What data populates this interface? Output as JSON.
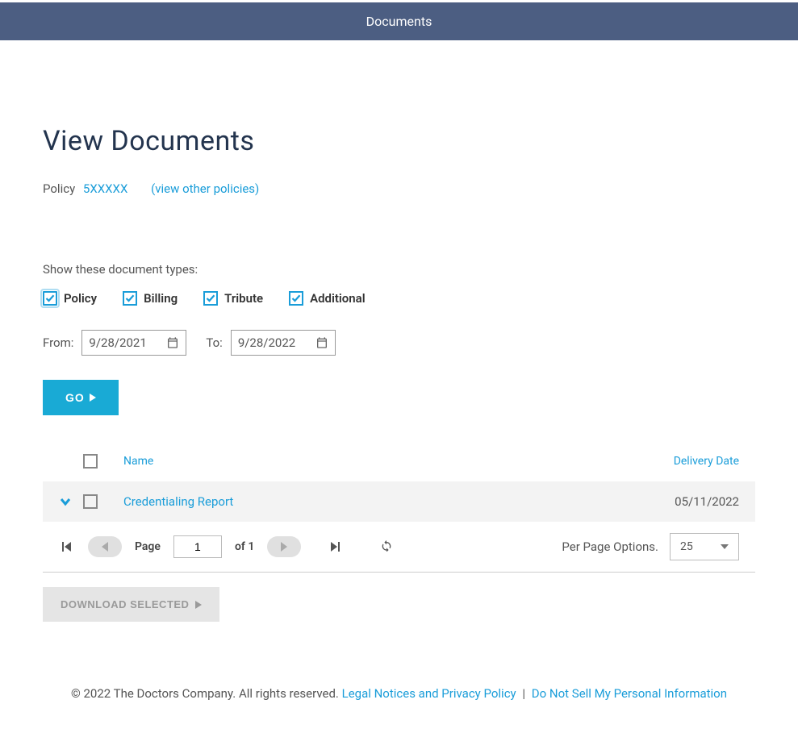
{
  "header": {
    "title": "Documents"
  },
  "page": {
    "title": "View Documents",
    "policy_label": "Policy",
    "policy_number": "5XXXXX",
    "view_other": "(view other policies)"
  },
  "filters": {
    "label": "Show these document types:",
    "types": [
      {
        "label": "Policy",
        "checked": true
      },
      {
        "label": "Billing",
        "checked": true
      },
      {
        "label": "Tribute",
        "checked": true
      },
      {
        "label": "Additional",
        "checked": true
      }
    ],
    "from_label": "From:",
    "from_value": "9/28/2021",
    "to_label": "To:",
    "to_value": "9/28/2022",
    "go_label": "GO"
  },
  "table": {
    "columns": {
      "name": "Name",
      "delivery_date": "Delivery Date"
    },
    "rows": [
      {
        "name": "Credentialing Report",
        "delivery_date": "05/11/2022"
      }
    ]
  },
  "pager": {
    "page_label": "Page",
    "page_value": "1",
    "of_label": "of 1",
    "per_page_label": "Per Page Options.",
    "per_page_value": "25"
  },
  "actions": {
    "download_selected": "DOWNLOAD SELECTED"
  },
  "footer": {
    "copyright": "© 2022 The Doctors Company. All rights reserved.",
    "legal": "Legal Notices and Privacy Policy",
    "do_not_sell": "Do Not Sell My Personal Information"
  }
}
